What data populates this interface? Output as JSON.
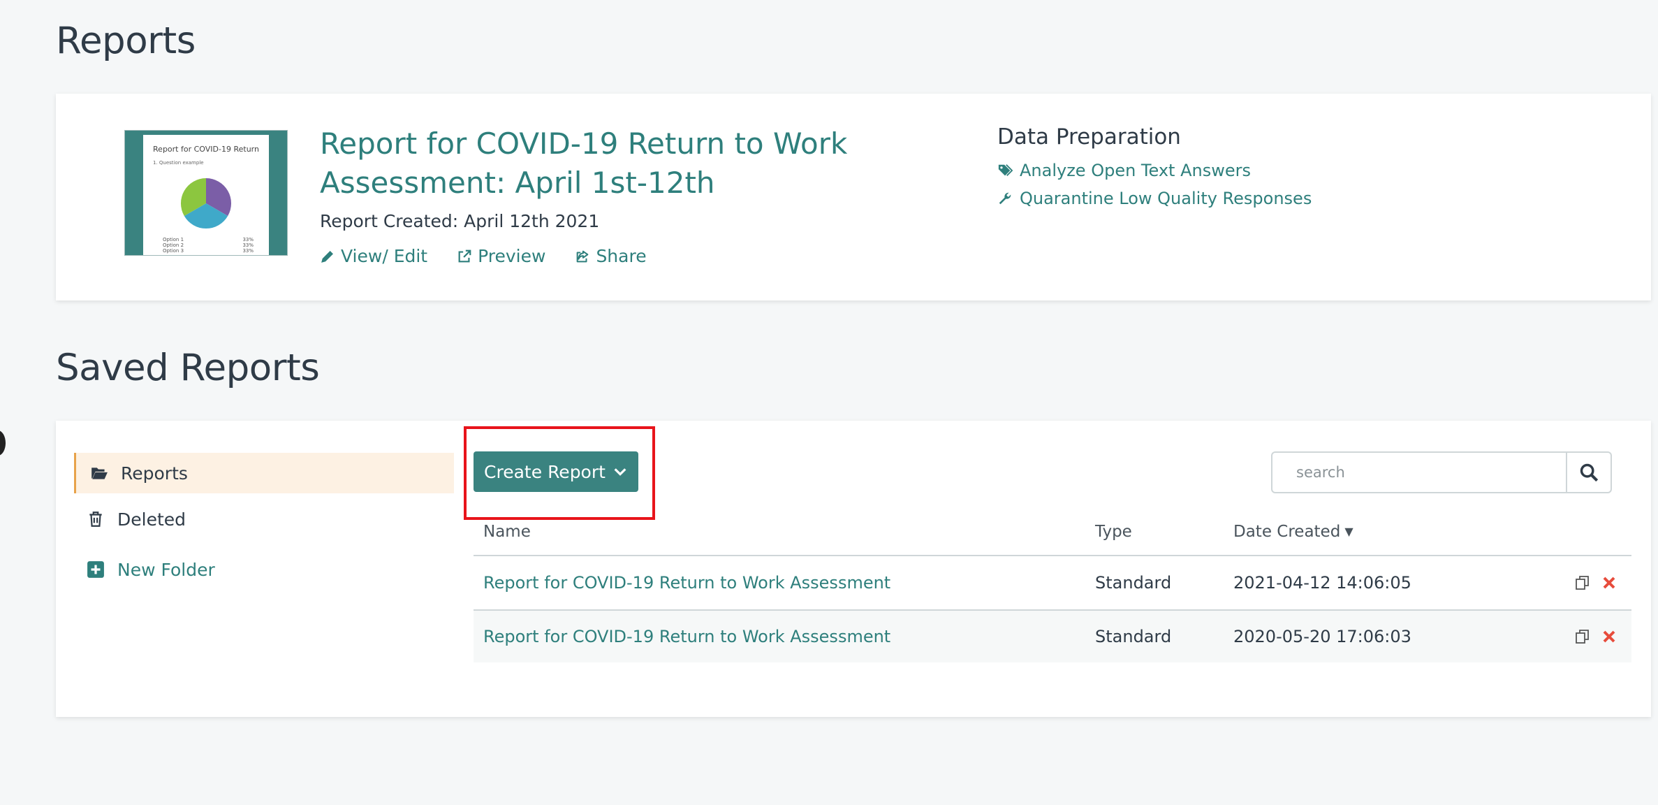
{
  "page": {
    "title": "Reports"
  },
  "featured_report": {
    "thumbnail": {
      "title": "Report for COVID-19 Return",
      "subtitle": "1. Question example",
      "options": [
        {
          "label": "Option 1",
          "value": "33%"
        },
        {
          "label": "Option 2",
          "value": "33%"
        },
        {
          "label": "Option 3",
          "value": "33%"
        }
      ],
      "colors": [
        "#7b5ea7",
        "#3fa9c9",
        "#8cc63f"
      ]
    },
    "title": "Report for COVID-19 Return to Work Assessment: April 1st-12th",
    "created": "Report Created: April 12th 2021",
    "actions": {
      "view_edit": "View/ Edit",
      "preview": "Preview",
      "share": "Share"
    },
    "data_preparation": {
      "title": "Data Preparation",
      "links": [
        "Analyze Open Text Answers",
        "Quarantine Low Quality Responses"
      ]
    }
  },
  "saved_reports": {
    "title": "Saved Reports",
    "nav": {
      "reports": "Reports",
      "deleted": "Deleted",
      "new_folder": "New Folder"
    },
    "create_button": "Create Report",
    "search": {
      "placeholder": "search",
      "value": ""
    },
    "table": {
      "headers": {
        "name": "Name",
        "type": "Type",
        "date": "Date Created"
      },
      "rows": [
        {
          "name": "Report for COVID-19 Return to Work Assessment",
          "type": "Standard",
          "date": "2021-04-12 14:06:05"
        },
        {
          "name": "Report for COVID-19 Return to Work Assessment",
          "type": "Standard",
          "date": "2020-05-20 17:06:03"
        }
      ]
    }
  },
  "colors": {
    "accent": "#3a8380",
    "link": "#2e7f7c",
    "highlight": "#e8141b",
    "delete": "#e74c3c"
  }
}
